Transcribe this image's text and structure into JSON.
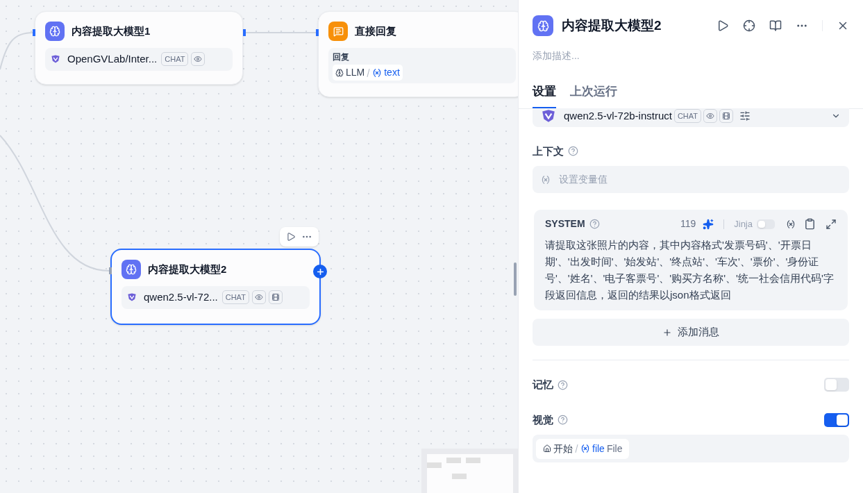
{
  "canvas": {
    "nodes": [
      {
        "kind": "llm",
        "title": "内容提取大模型1",
        "selected": false,
        "model": {
          "name": "OpenGVLab/Inter...",
          "mode": "CHAT",
          "vision": true,
          "video": false
        }
      },
      {
        "kind": "answer",
        "title": "直接回复",
        "selected": false,
        "field_label": "回复",
        "ref": {
          "node": "LLM",
          "var": "text"
        }
      },
      {
        "kind": "llm",
        "title": "内容提取大模型2",
        "selected": true,
        "model": {
          "name": "qwen2.5-vl-72...",
          "mode": "CHAT",
          "vision": true,
          "video": true
        }
      }
    ]
  },
  "panel": {
    "title": "内容提取大模型2",
    "description_placeholder": "添加描述...",
    "tabs": [
      {
        "label": "设置",
        "selected": true
      },
      {
        "label": "上次运行",
        "selected": false
      }
    ],
    "model": {
      "name": "qwen2.5-vl-72b-instruct",
      "mode": "CHAT",
      "vision": true,
      "video": true
    },
    "context": {
      "label": "上下文",
      "placeholder": "设置变量值"
    },
    "system": {
      "role": "SYSTEM",
      "count": "119",
      "jinja_label": "Jinja",
      "jinja_on": false,
      "text": "请提取这张照片的内容，其中内容格式'发票号码'、'开票日期'、'出发时间'、'始发站'、'终点站'、'车次'、'票价'、'身份证号'、'姓名'、'电子客票号'、'购买方名称'、'统一社会信用代码'字段返回信息，返回的结果以json格式返回"
    },
    "add_message": "添加消息",
    "memory": {
      "label": "记忆",
      "on": false
    },
    "vision": {
      "label": "视觉",
      "on": true,
      "ref": {
        "node": "开始",
        "var": "file",
        "type": "File"
      }
    }
  }
}
